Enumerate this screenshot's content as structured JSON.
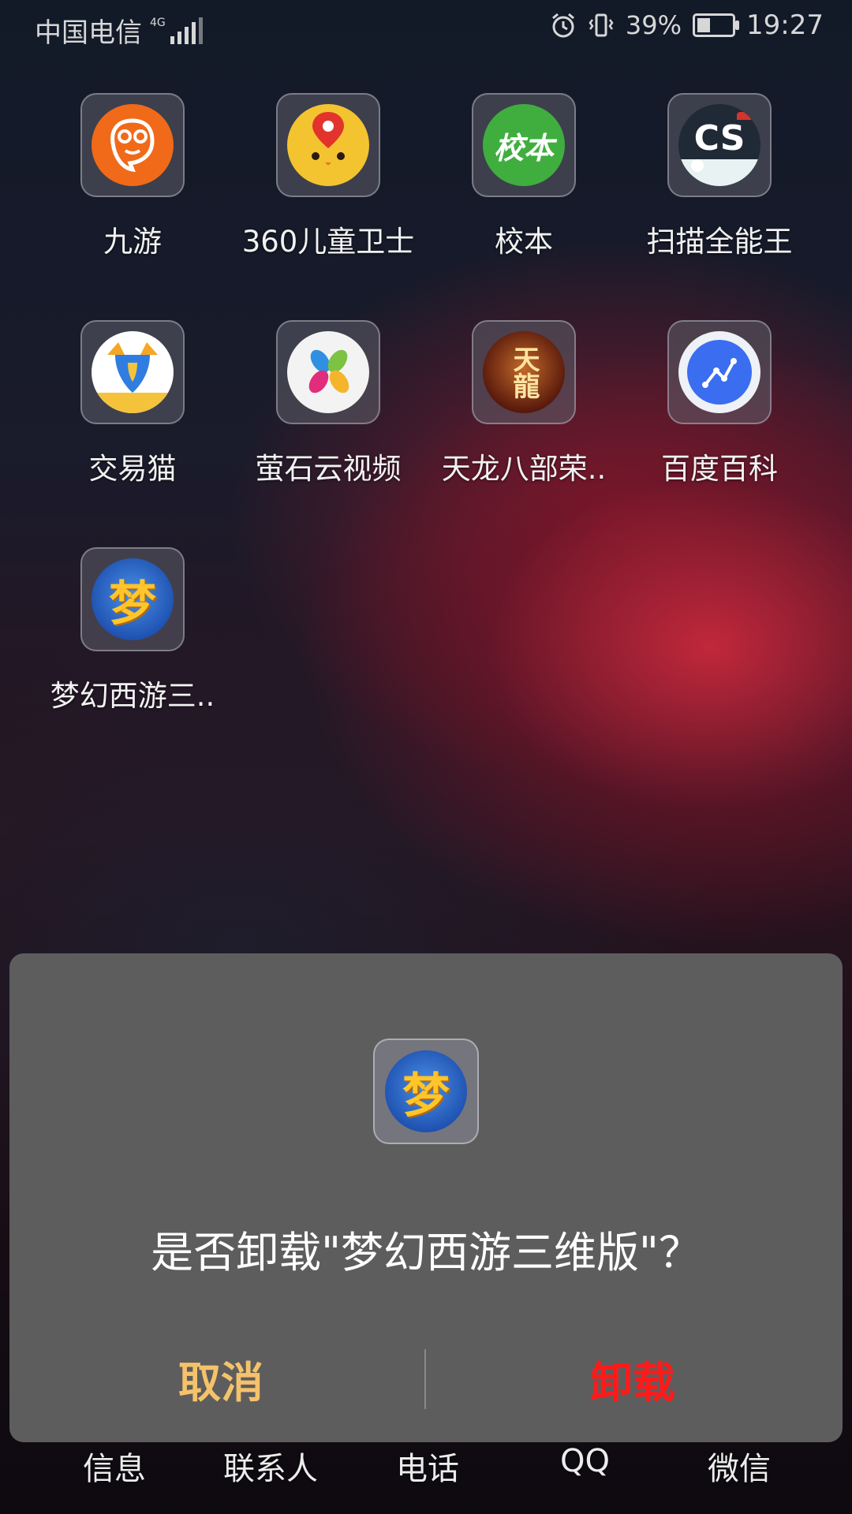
{
  "status_bar": {
    "carrier": "中国电信",
    "network": "4G",
    "battery_percent": "39%",
    "battery_level": 0.39,
    "time": "19:27",
    "icons": [
      "alarm-icon",
      "vibrate-icon",
      "battery-icon",
      "signal-icon"
    ]
  },
  "apps": [
    {
      "label": "九游",
      "icon": "jiuyou-icon",
      "color": "#f06a1a"
    },
    {
      "label": "360儿童卫士",
      "icon": "360-kids-guard-icon",
      "color": "#f4c430"
    },
    {
      "label": "校本",
      "icon": "xiaoben-icon",
      "color": "#3fae3f",
      "icon_text": "校本"
    },
    {
      "label": "扫描全能王",
      "icon": "camscanner-icon",
      "color": "#1f2a36",
      "icon_text": "CS"
    },
    {
      "label": "交易猫",
      "icon": "jiaoyimao-icon",
      "color": "#f5c33b"
    },
    {
      "label": "萤石云视频",
      "icon": "ezviz-icon",
      "color": "#ffffff"
    },
    {
      "label": "天龙八部荣..",
      "icon": "tianlong-icon",
      "color": "#6a2414",
      "icon_text": "天龍"
    },
    {
      "label": "百度百科",
      "icon": "baidu-baike-icon",
      "color": "#3a6df0"
    },
    {
      "label": "梦幻西游三..",
      "icon": "menghuan-icon",
      "color": "#2f6ed6",
      "icon_text": "梦"
    }
  ],
  "dialog": {
    "question": "是否卸载\"梦幻西游三维版\"？",
    "cancel_label": "取消",
    "uninstall_label": "卸载",
    "cancel_color": "#f5c26b",
    "uninstall_color": "#ff1a1a",
    "app_icon": "menghuan-icon",
    "app_icon_text": "梦"
  },
  "dock": [
    "信息",
    "联系人",
    "电话",
    "QQ",
    "微信"
  ]
}
